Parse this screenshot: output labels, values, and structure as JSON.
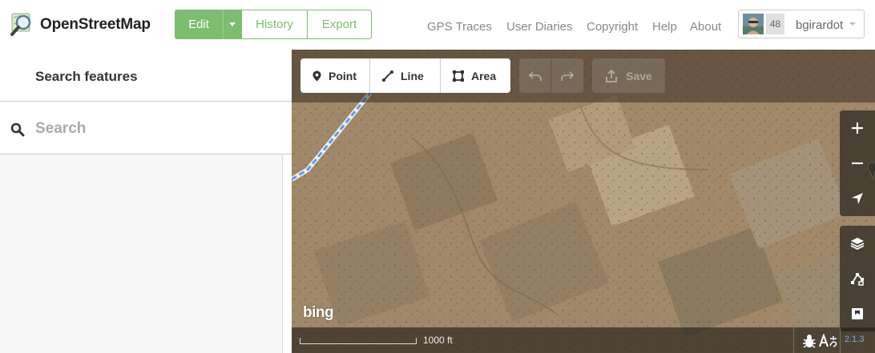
{
  "header": {
    "brand": "OpenStreetMap",
    "buttons": {
      "edit": "Edit",
      "history": "History",
      "export": "Export"
    },
    "nav": [
      "GPS Traces",
      "User Diaries",
      "Copyright",
      "Help",
      "About"
    ],
    "user": {
      "count": "48",
      "name": "bgirardot"
    },
    "colors": {
      "accent": "#7ebc6f"
    }
  },
  "sidebar": {
    "title": "Search features",
    "search_placeholder": "Search"
  },
  "map": {
    "tools": {
      "point": "Point",
      "line": "Line",
      "area": "Area"
    },
    "save_label": "Save",
    "controls": [
      "zoom-in-icon",
      "zoom-out-icon",
      "geolocate-icon",
      "layers-icon",
      "map-data-icon",
      "help-icon"
    ],
    "imagery_logo": "bing",
    "scale_label": "1000 ft",
    "version": "2.1.3"
  }
}
